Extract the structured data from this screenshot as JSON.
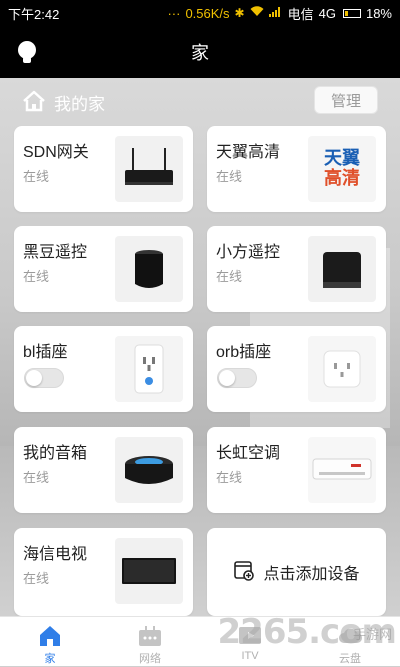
{
  "status_bar": {
    "time": "下午2:42",
    "dots": "···",
    "speed": "0.56K/s",
    "carrier": "电信",
    "network": "4G",
    "battery": "18%",
    "battery_fraction": 0.18
  },
  "header": {
    "title": "家"
  },
  "section": {
    "title": "我的家",
    "manage_label": "管理"
  },
  "devices": [
    {
      "name": "SDN网关",
      "status": "在线",
      "icon": "router-icon"
    },
    {
      "name": "天翼高清",
      "status": "在线",
      "icon": "tianyi-logo"
    },
    {
      "name": "黑豆遥控",
      "status": "在线",
      "icon": "black-bean-remote-icon"
    },
    {
      "name": "小方遥控",
      "status": "在线",
      "icon": "cube-remote-icon"
    },
    {
      "name": "bl插座",
      "toggle": false,
      "icon": "smart-plug-icon"
    },
    {
      "name": "orb插座",
      "toggle": false,
      "icon": "smart-plug-icon"
    },
    {
      "name": "我的音箱",
      "status": "在线",
      "icon": "speaker-icon"
    },
    {
      "name": "长虹空调",
      "status": "在线",
      "icon": "air-conditioner-icon"
    },
    {
      "name": "海信电视",
      "status": "在线",
      "icon": "tv-icon"
    }
  ],
  "add_device": {
    "label": "点击添加设备"
  },
  "tianyi_logo": {
    "line1": "天翼",
    "line2": "高清"
  },
  "tabs": [
    {
      "label": "家",
      "active": true,
      "icon": "home-icon"
    },
    {
      "label": "网络",
      "active": false,
      "icon": "network-icon"
    },
    {
      "label": "ITV",
      "active": false,
      "icon": "itv-icon"
    },
    {
      "label": "云盘",
      "active": false,
      "icon": "cloud-icon"
    }
  ],
  "watermark": {
    "main": "2265.com",
    "sub": "手游网"
  },
  "colors": {
    "accent": "#2f7ee8",
    "status_gray": "#9b9b9b",
    "header_bg": "#000000"
  }
}
